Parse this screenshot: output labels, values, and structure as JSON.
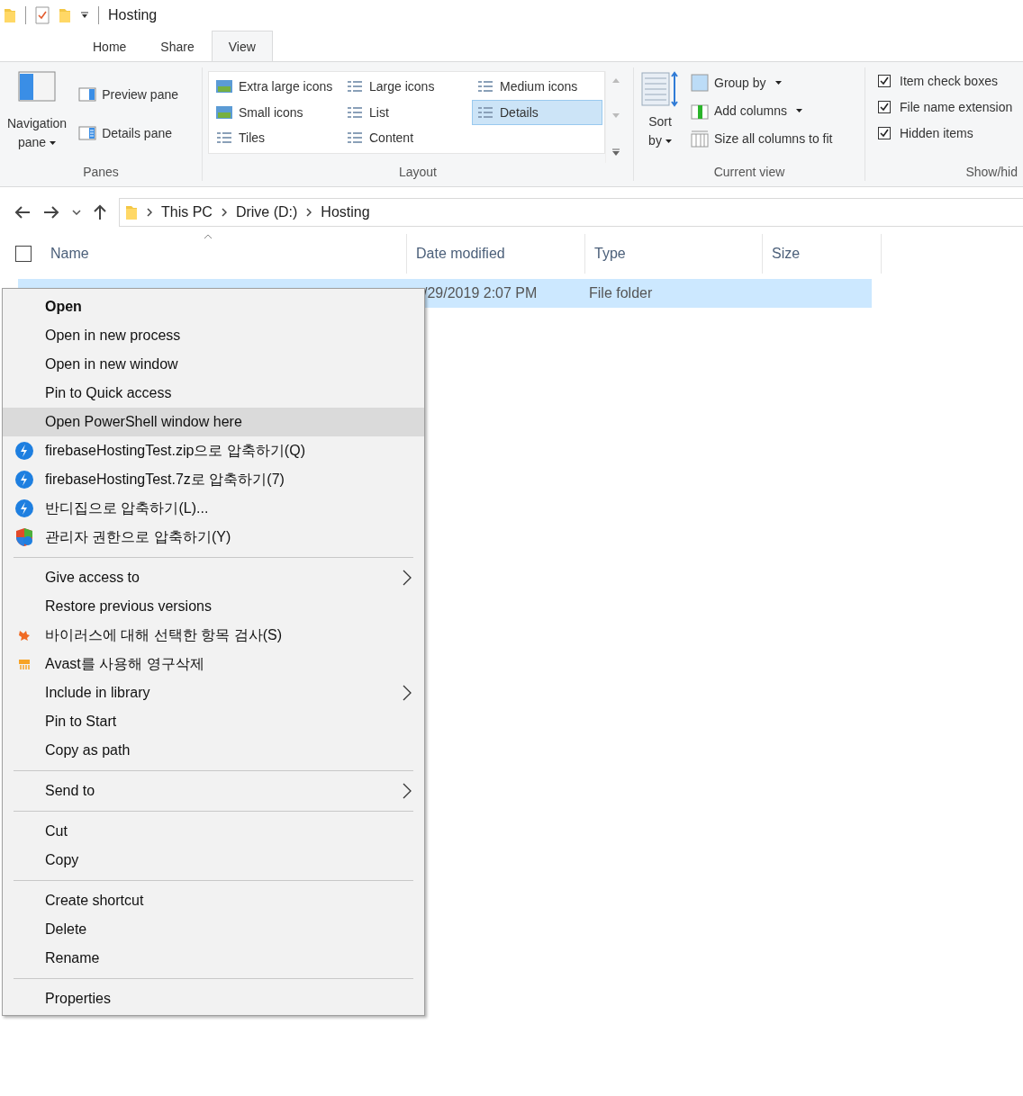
{
  "window": {
    "title": "Hosting"
  },
  "tabs": [
    {
      "label": "Home",
      "selected": false
    },
    {
      "label": "Share",
      "selected": false
    },
    {
      "label": "View",
      "selected": true
    }
  ],
  "ribbon": {
    "panes": {
      "label": "Panes",
      "navigation": [
        "Navigation",
        "pane"
      ],
      "items": [
        "Preview pane",
        "Details pane"
      ]
    },
    "layout": {
      "label": "Layout",
      "options": [
        {
          "label": "Extra large icons",
          "selected": false
        },
        {
          "label": "Large icons",
          "selected": false
        },
        {
          "label": "Medium icons",
          "selected": false
        },
        {
          "label": "Small icons",
          "selected": false
        },
        {
          "label": "List",
          "selected": false
        },
        {
          "label": "Details",
          "selected": true
        },
        {
          "label": "Tiles",
          "selected": false
        },
        {
          "label": "Content",
          "selected": false
        }
      ]
    },
    "current_view": {
      "label": "Current view",
      "sort": [
        "Sort",
        "by"
      ],
      "items": [
        "Group by",
        "Add columns",
        "Size all columns to fit"
      ]
    },
    "show_hide": {
      "label": "Show/hid",
      "options": [
        {
          "label": "Item check boxes",
          "checked": true
        },
        {
          "label": "File name extension",
          "checked": true
        },
        {
          "label": "Hidden items",
          "checked": true
        }
      ]
    }
  },
  "address": {
    "path": [
      "This PC",
      "Drive (D:)",
      "Hosting"
    ]
  },
  "table": {
    "select_all_checked": false,
    "columns": [
      "Name",
      "Date modified",
      "Type",
      "Size"
    ],
    "rows": [
      {
        "date": "/29/2019 2:07 PM",
        "type": "File folder",
        "selected": true
      }
    ]
  },
  "context_menu": {
    "sections": [
      [
        {
          "label": "Open",
          "kind": "plain",
          "default": true,
          "submenu": false,
          "selected": false
        },
        {
          "label": "Open in new process",
          "kind": "plain",
          "default": false,
          "submenu": false,
          "selected": false
        },
        {
          "label": "Open in new window",
          "kind": "plain",
          "default": false,
          "submenu": false,
          "selected": false
        },
        {
          "label": "Pin to Quick access",
          "kind": "plain",
          "default": false,
          "submenu": false,
          "selected": false
        },
        {
          "label": "Open PowerShell window here",
          "kind": "plain",
          "default": false,
          "submenu": false,
          "selected": true
        },
        {
          "label": "firebaseHostingTest.zip으로 압축하기(Q)",
          "kind": "compress",
          "default": false,
          "submenu": false,
          "selected": false
        },
        {
          "label": "firebaseHostingTest.7z로 압축하기(7)",
          "kind": "compress",
          "default": false,
          "submenu": false,
          "selected": false
        },
        {
          "label": "반디집으로 압축하기(L)...",
          "kind": "compress",
          "default": false,
          "submenu": false,
          "selected": false
        },
        {
          "label": "관리자 권한으로 압축하기(Y)",
          "kind": "admin",
          "default": false,
          "submenu": false,
          "selected": false
        }
      ],
      [
        {
          "label": "Give access to",
          "kind": "plain",
          "default": false,
          "submenu": true,
          "selected": false
        },
        {
          "label": "Restore previous versions",
          "kind": "plain",
          "default": false,
          "submenu": false,
          "selected": false
        },
        {
          "label": "바이러스에 대해 선택한 항목 검사(S)",
          "kind": "scan",
          "default": false,
          "submenu": false,
          "selected": false
        },
        {
          "label": "Avast를 사용해 영구삭제",
          "kind": "shred",
          "default": false,
          "submenu": false,
          "selected": false
        },
        {
          "label": "Include in library",
          "kind": "plain",
          "default": false,
          "submenu": true,
          "selected": false
        },
        {
          "label": "Pin to Start",
          "kind": "plain",
          "default": false,
          "submenu": false,
          "selected": false
        },
        {
          "label": "Copy as path",
          "kind": "plain",
          "default": false,
          "submenu": false,
          "selected": false
        }
      ],
      [
        {
          "label": "Send to",
          "kind": "plain",
          "default": false,
          "submenu": true,
          "selected": false
        }
      ],
      [
        {
          "label": "Cut",
          "kind": "plain",
          "default": false,
          "submenu": false,
          "selected": false
        },
        {
          "label": "Copy",
          "kind": "plain",
          "default": false,
          "submenu": false,
          "selected": false
        }
      ],
      [
        {
          "label": "Create shortcut",
          "kind": "plain",
          "default": false,
          "submenu": false,
          "selected": false
        },
        {
          "label": "Delete",
          "kind": "plain",
          "default": false,
          "submenu": false,
          "selected": false
        },
        {
          "label": "Rename",
          "kind": "plain",
          "default": false,
          "submenu": false,
          "selected": false
        }
      ],
      [
        {
          "label": "Properties",
          "kind": "plain",
          "default": false,
          "submenu": false,
          "selected": false
        }
      ]
    ]
  }
}
